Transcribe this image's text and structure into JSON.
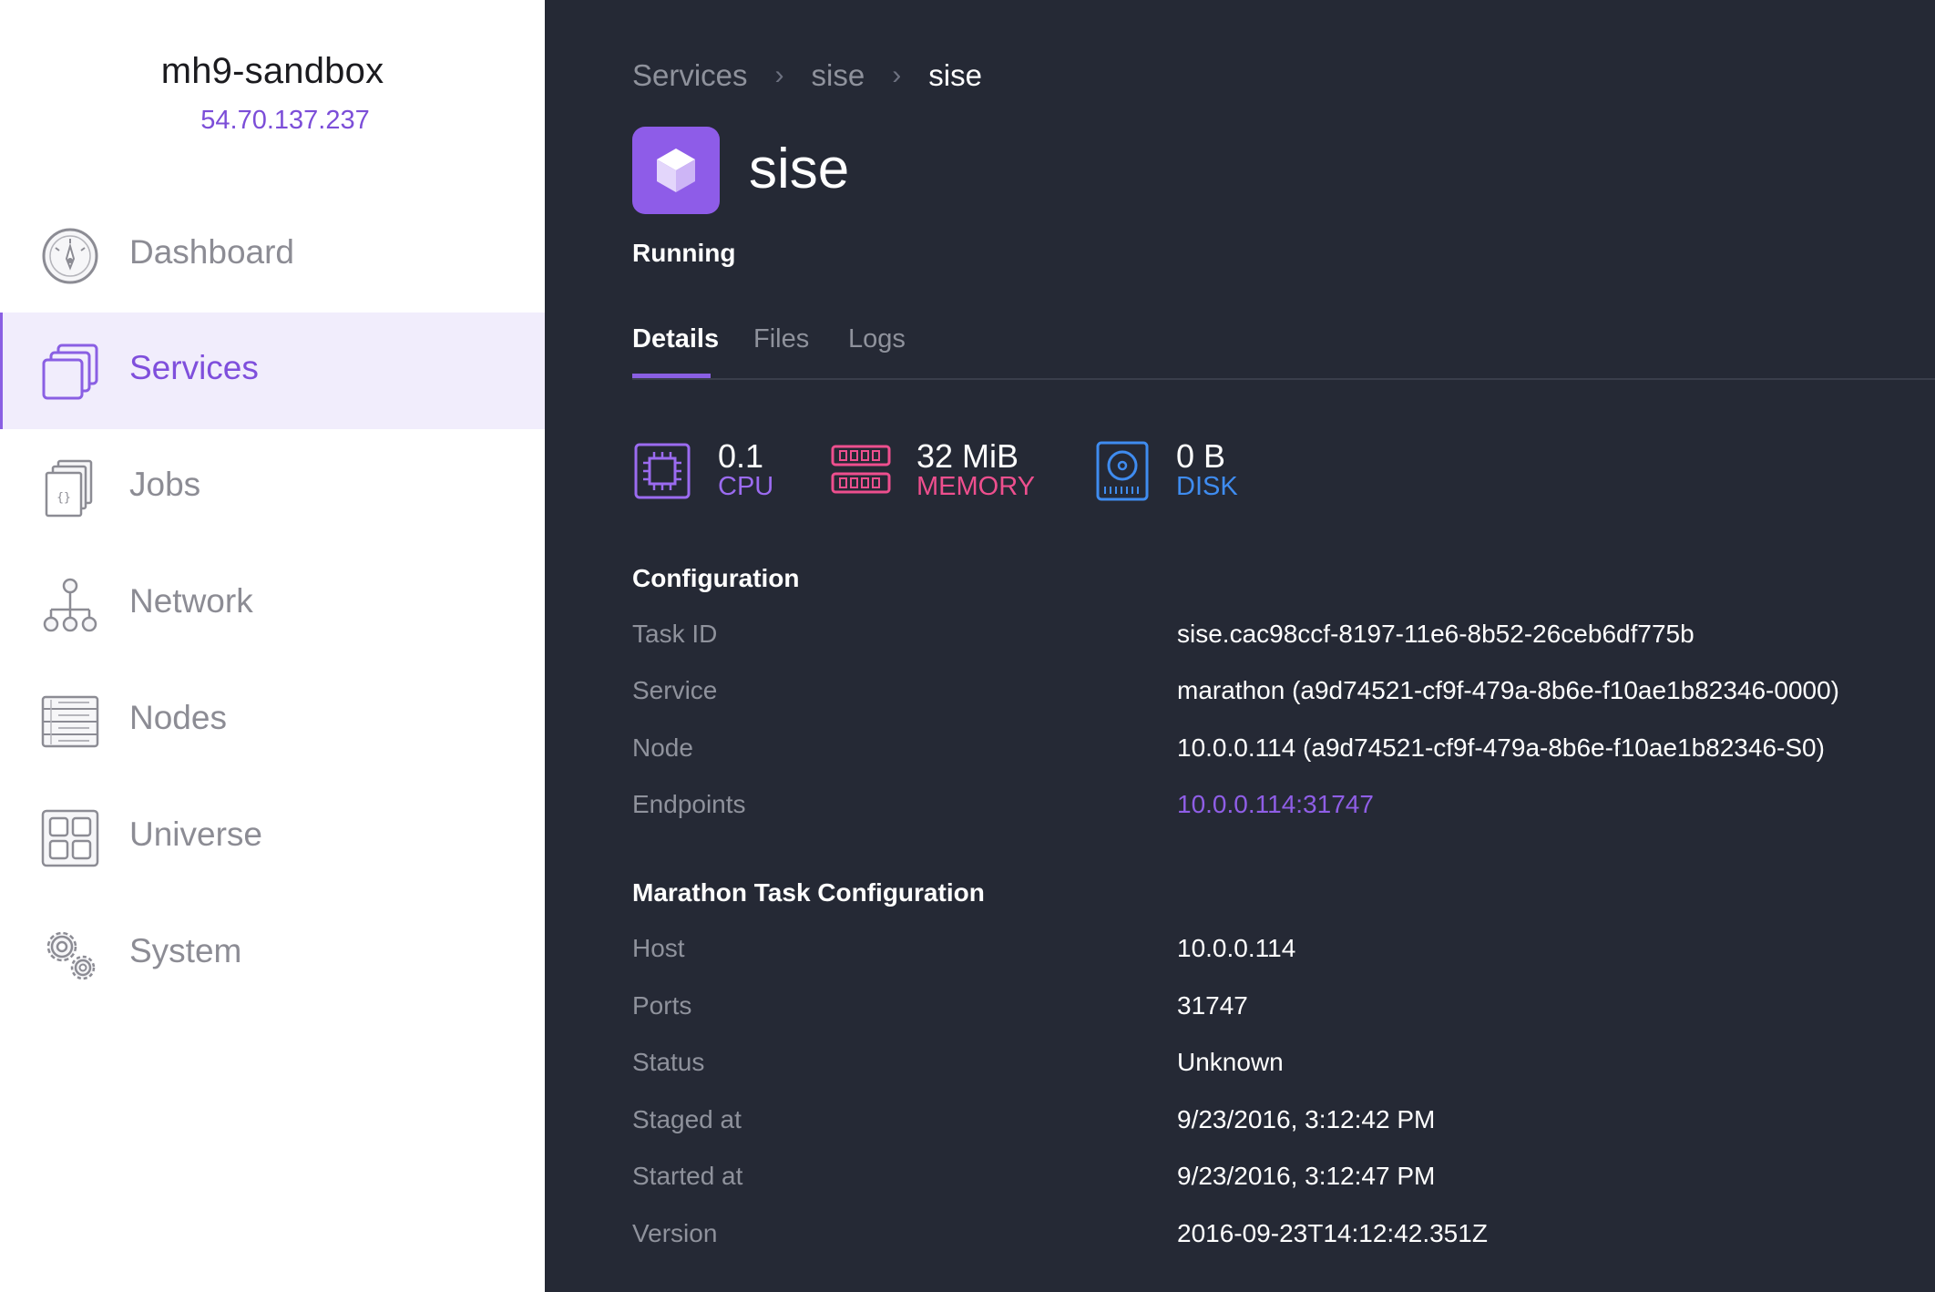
{
  "sidebar": {
    "cluster_name": "mh9-sandbox",
    "cluster_ip": "54.70.137.237",
    "items": [
      {
        "label": "Dashboard",
        "icon": "dashboard-gauge-icon",
        "active": false
      },
      {
        "label": "Services",
        "icon": "services-stack-icon",
        "active": true
      },
      {
        "label": "Jobs",
        "icon": "jobs-document-icon",
        "active": false
      },
      {
        "label": "Network",
        "icon": "network-tree-icon",
        "active": false
      },
      {
        "label": "Nodes",
        "icon": "nodes-server-icon",
        "active": false
      },
      {
        "label": "Universe",
        "icon": "universe-grid-icon",
        "active": false
      },
      {
        "label": "System",
        "icon": "system-gears-icon",
        "active": false
      }
    ]
  },
  "breadcrumb": [
    "Services",
    "sise",
    "sise"
  ],
  "service": {
    "name": "sise",
    "status": "Running",
    "icon": "cube-icon",
    "icon_color": "#8e5ce8"
  },
  "tabs": [
    {
      "label": "Details",
      "active": true
    },
    {
      "label": "Files",
      "active": false
    },
    {
      "label": "Logs",
      "active": false
    }
  ],
  "resources": [
    {
      "value": "0.1",
      "label": "CPU",
      "color": "#9b6bf0",
      "icon": "cpu-chip-icon"
    },
    {
      "value": "32 MiB",
      "label": "MEMORY",
      "color": "#ee4f8e",
      "icon": "memory-ram-icon"
    },
    {
      "value": "0 B",
      "label": "DISK",
      "color": "#3f8cf0",
      "icon": "disk-drive-icon"
    }
  ],
  "configuration": {
    "title": "Configuration",
    "rows": [
      {
        "key": "Task ID",
        "value": "sise.cac98ccf-8197-11e6-8b52-26ceb6df775b"
      },
      {
        "key": "Service",
        "value": "marathon (a9d74521-cf9f-479a-8b6e-f10ae1b82346-0000)"
      },
      {
        "key": "Node",
        "value": "10.0.0.114 (a9d74521-cf9f-479a-8b6e-f10ae1b82346-S0)"
      },
      {
        "key": "Endpoints",
        "value": "10.0.0.114:31747"
      }
    ]
  },
  "marathon": {
    "title": "Marathon Task Configuration",
    "rows": [
      {
        "key": "Host",
        "value": "10.0.0.114"
      },
      {
        "key": "Ports",
        "value": "31747"
      },
      {
        "key": "Status",
        "value": "Unknown"
      },
      {
        "key": "Staged at",
        "value": "9/23/2016, 3:12:42 PM"
      },
      {
        "key": "Started at",
        "value": "9/23/2016, 3:12:47 PM"
      },
      {
        "key": "Version",
        "value": "2016-09-23T14:12:42.351Z"
      }
    ]
  },
  "colors": {
    "accent": "#8a5fe3",
    "main_bg": "#252935",
    "sidebar_active_bg": "#f1edfc"
  }
}
